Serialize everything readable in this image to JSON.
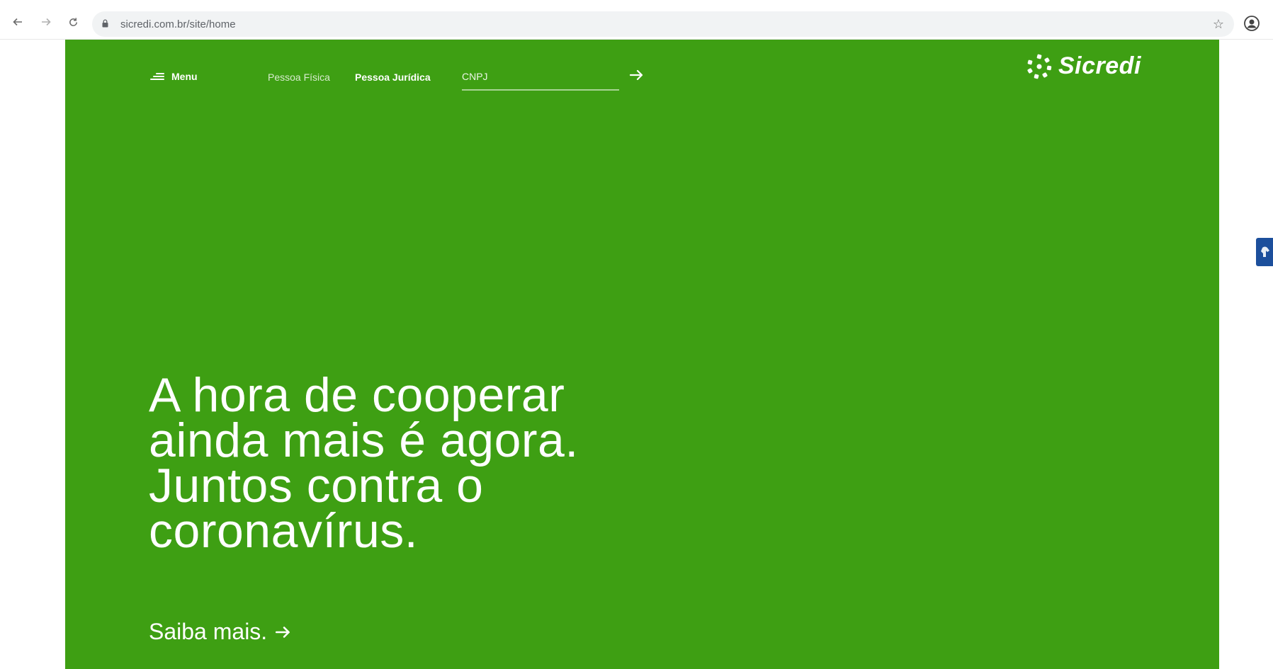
{
  "browser": {
    "url": "sicredi.com.br/site/home",
    "back_icon": "arrow-left-icon",
    "forward_icon": "arrow-right-icon",
    "reload_icon": "reload-icon",
    "lock_icon": "lock-icon",
    "bookmark_icon": "star-icon",
    "profile_icon": "account-circle-icon"
  },
  "header": {
    "menu_label": "Menu",
    "segment_pf": "Pessoa Física",
    "segment_pj": "Pessoa Jurídica",
    "cnpj_placeholder": "CNPJ",
    "logo_text": "Sicredi"
  },
  "hero": {
    "headline_lines": [
      "A hora de cooperar",
      "ainda mais é agora.",
      "Juntos contra o",
      "coronavírus."
    ],
    "cta_label": "Saiba mais."
  },
  "colors": {
    "brand_green": "#3e9f13",
    "widget_blue": "#1c4f9c",
    "text_white": "#ffffff"
  }
}
